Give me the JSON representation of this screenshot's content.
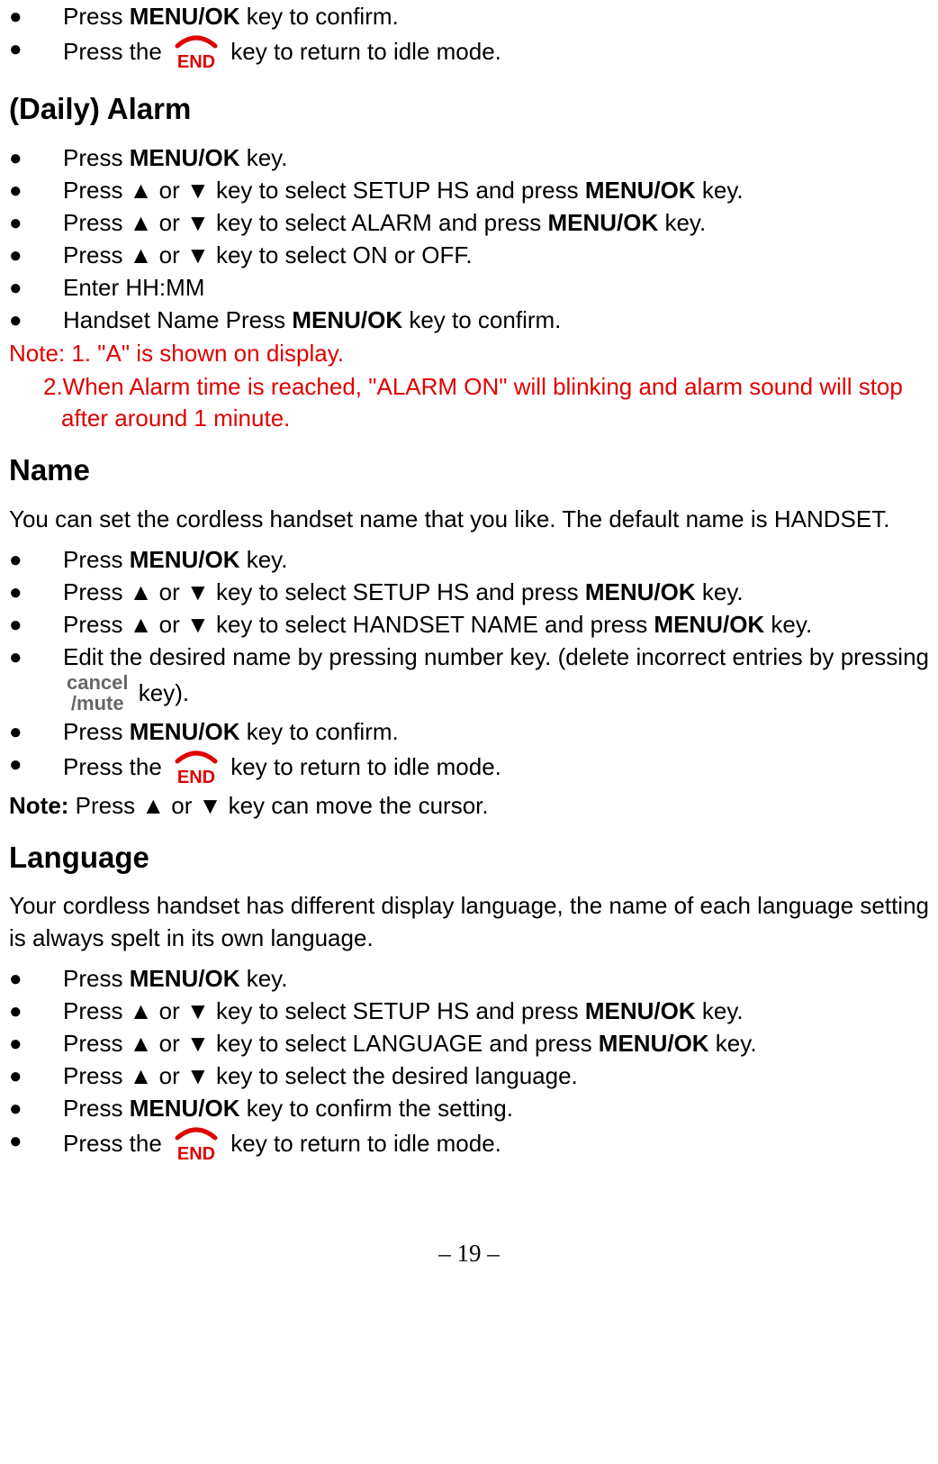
{
  "section1": {
    "item1_pre": "Press ",
    "item1_bold": "MENU/OK",
    "item1_post": " key to confirm.",
    "item2_pre": "Press the ",
    "item2_post": " key to return to idle mode."
  },
  "alarm": {
    "heading": "(Daily) Alarm",
    "items": [
      {
        "pre": "Press ",
        "bold": "MENU/OK",
        "post": " key."
      },
      {
        "pre": "Press ▲ or ▼ key to select SETUP HS and press ",
        "bold": "MENU/OK",
        "post": " key."
      },
      {
        "pre": "Press ▲ or ▼ key to select ALARM and press ",
        "bold": "MENU/OK",
        "post": " key."
      },
      {
        "pre": "Press ▲ or ▼ key to select ON or OFF.",
        "bold": "",
        "post": ""
      },
      {
        "pre": "Enter HH:MM",
        "bold": "",
        "post": ""
      },
      {
        "pre": "Handset Name Press ",
        "bold": "MENU/OK",
        "post": " key to confirm."
      }
    ],
    "note1": "Note: 1. \"A\" is shown on display.",
    "note2": "2.When Alarm time is reached, \"ALARM ON\" will blinking and alarm sound will stop after around 1 minute."
  },
  "name": {
    "heading": "Name",
    "intro": "You can set the cordless handset name that you like. The default name is HANDSET.",
    "items": {
      "i1": {
        "pre": "Press ",
        "bold": "MENU/OK",
        "post": " key."
      },
      "i2": {
        "pre": "Press ▲ or ▼ key to select SETUP HS and press ",
        "bold": "MENU/OK",
        "post": " key."
      },
      "i3": {
        "pre": "Press ▲ or ▼ key to select HANDSET NAME and press ",
        "bold": "MENU/OK",
        "post": " key."
      },
      "i4_part1": "Edit the desired name by pressing number key. (delete incorrect entries by pressing ",
      "i4_part2": " key).",
      "i5": {
        "pre": "Press ",
        "bold": "MENU/OK",
        "post": " key to confirm."
      },
      "i6_pre": "Press the ",
      "i6_post": " key to return to idle mode."
    },
    "note_bold": "Note:",
    "note_rest": " Press ▲ or ▼ key can move the cursor."
  },
  "language": {
    "heading": "Language",
    "intro": "Your cordless handset has different display language, the name of each language setting is always spelt in its own language.",
    "items": {
      "i1": {
        "pre": "Press ",
        "bold": "MENU/OK",
        "post": " key."
      },
      "i2": {
        "pre": "Press ▲ or ▼ key to select SETUP HS and press ",
        "bold": "MENU/OK",
        "post": " key."
      },
      "i3": {
        "pre": "Press ▲ or ▼ key to select LANGUAGE and press ",
        "bold": "MENU/OK",
        "post": " key."
      },
      "i4": {
        "pre": "Press ▲ or ▼ key to select the desired language.",
        "bold": "",
        "post": ""
      },
      "i5": {
        "pre": "Press ",
        "bold": "MENU/OK",
        "post": " key to confirm the setting."
      },
      "i6_pre": "Press the ",
      "i6_post": " key to return to idle mode."
    }
  },
  "icons": {
    "end_label": "END",
    "cancel_line1": "cancel",
    "cancel_line2": "/mute"
  },
  "page_number": "– 19 –"
}
